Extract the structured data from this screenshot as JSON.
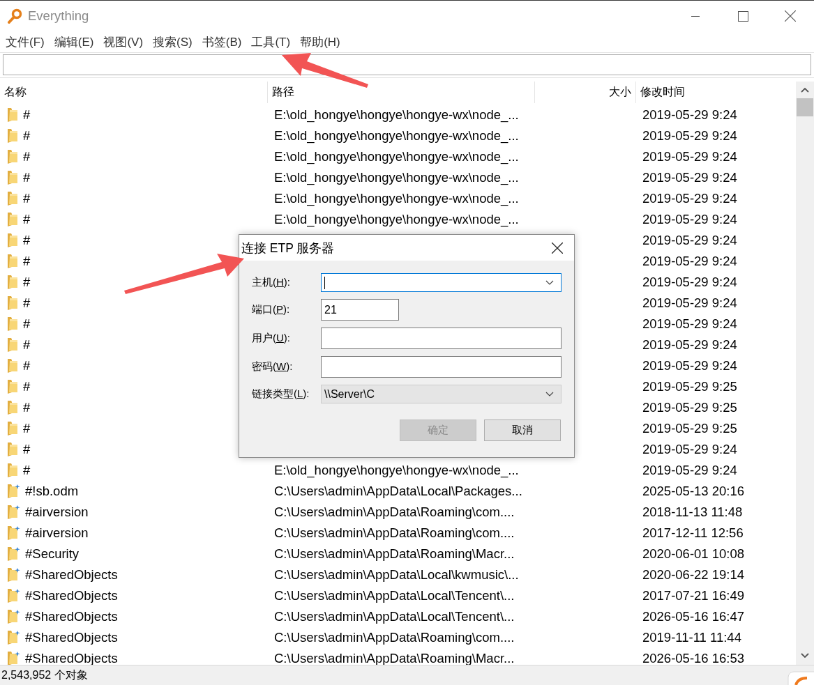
{
  "window": {
    "title": "Everything"
  },
  "menu": [
    "文件(F)",
    "编辑(E)",
    "视图(V)",
    "搜索(S)",
    "书签(B)",
    "工具(T)",
    "帮助(H)"
  ],
  "table": {
    "columns": [
      "名称",
      "路径",
      "大小",
      "修改时间"
    ],
    "rows": [
      {
        "kind": "folder",
        "name": "#",
        "path": "E:\\old_hongye\\hongye\\hongye-wx\\node_...",
        "modified": "2019-05-29 9:24"
      },
      {
        "kind": "folder",
        "name": "#",
        "path": "E:\\old_hongye\\hongye\\hongye-wx\\node_...",
        "modified": "2019-05-29 9:24"
      },
      {
        "kind": "folder",
        "name": "#",
        "path": "E:\\old_hongye\\hongye\\hongye-wx\\node_...",
        "modified": "2019-05-29 9:24"
      },
      {
        "kind": "folder",
        "name": "#",
        "path": "E:\\old_hongye\\hongye\\hongye-wx\\node_...",
        "modified": "2019-05-29 9:24"
      },
      {
        "kind": "folder",
        "name": "#",
        "path": "E:\\old_hongye\\hongye\\hongye-wx\\node_...",
        "modified": "2019-05-29 9:24"
      },
      {
        "kind": "folder",
        "name": "#",
        "path": "E:\\old_hongye\\hongye\\hongye-wx\\node_...",
        "modified": "2019-05-29 9:24"
      },
      {
        "kind": "folder",
        "name": "#",
        "modified": "2019-05-29 9:24"
      },
      {
        "kind": "folder",
        "name": "#",
        "modified": "2019-05-29 9:24"
      },
      {
        "kind": "folder",
        "name": "#",
        "modified": "2019-05-29 9:24"
      },
      {
        "kind": "folder",
        "name": "#",
        "modified": "2019-05-29 9:24"
      },
      {
        "kind": "folder",
        "name": "#",
        "modified": "2019-05-29 9:24"
      },
      {
        "kind": "folder",
        "name": "#",
        "modified": "2019-05-29 9:24"
      },
      {
        "kind": "folder",
        "name": "#",
        "modified": "2019-05-29 9:24"
      },
      {
        "kind": "folder",
        "name": "#",
        "modified": "2019-05-29 9:25"
      },
      {
        "kind": "folder",
        "name": "#",
        "modified": "2019-05-29 9:25"
      },
      {
        "kind": "folder",
        "name": "#",
        "modified": "2019-05-29 9:25"
      },
      {
        "kind": "folder",
        "name": "#",
        "modified": "2019-05-29 9:24"
      },
      {
        "kind": "folder",
        "name": "#",
        "path": "E:\\old_hongye\\hongye\\hongye-wx\\node_...",
        "modified": "2019-05-29 9:24"
      },
      {
        "kind": "marked",
        "name": "#!sb.odm",
        "path": "C:\\Users\\admin\\AppData\\Local\\Packages...",
        "modified": "2025-05-13 20:16"
      },
      {
        "kind": "marked",
        "name": "#airversion",
        "path": "C:\\Users\\admin\\AppData\\Roaming\\com....",
        "modified": "2018-11-13 11:48"
      },
      {
        "kind": "marked",
        "name": "#airversion",
        "path": "C:\\Users\\admin\\AppData\\Roaming\\com....",
        "modified": "2017-12-11 12:56"
      },
      {
        "kind": "marked",
        "name": "#Security",
        "path": "C:\\Users\\admin\\AppData\\Roaming\\Macr...",
        "modified": "2020-06-01 10:08"
      },
      {
        "kind": "marked",
        "name": "#SharedObjects",
        "path": "C:\\Users\\admin\\AppData\\Local\\kwmusic\\...",
        "modified": "2020-06-22 19:14"
      },
      {
        "kind": "marked",
        "name": "#SharedObjects",
        "path": "C:\\Users\\admin\\AppData\\Local\\Tencent\\...",
        "modified": "2017-07-21 16:49"
      },
      {
        "kind": "marked",
        "name": "#SharedObjects",
        "path": "C:\\Users\\admin\\AppData\\Local\\Tencent\\...",
        "modified": "2026-05-16 16:47"
      },
      {
        "kind": "marked",
        "name": "#SharedObjects",
        "path": "C:\\Users\\admin\\AppData\\Roaming\\com....",
        "modified": "2019-11-11 11:44"
      },
      {
        "kind": "marked",
        "name": "#SharedObjects",
        "path": "C:\\Users\\admin\\AppData\\Roaming\\Macr...",
        "modified": "2026-05-16 16:53"
      }
    ]
  },
  "status_bar": {
    "text": "2,543,952 个对象"
  },
  "dialog": {
    "title": "连接 ETP 服务器",
    "fields": [
      {
        "kind": "combo",
        "label": "主机(",
        "key": "H",
        "label_end": "):",
        "focused": true
      },
      {
        "kind": "short",
        "label": "端口(",
        "key": "P",
        "label_end": "):",
        "value": "21",
        "focused": false
      },
      {
        "kind": "text",
        "label": "用户(",
        "key": "U",
        "label_end": "):",
        "focused": false
      },
      {
        "kind": "text",
        "label": "密码(",
        "key": "W",
        "label_end": "):",
        "focused": false
      },
      {
        "kind": "select",
        "label": "链接类型(",
        "key": "L",
        "label_end": "):",
        "value": "\\\\Server\\C",
        "focused": false
      }
    ],
    "buttons": [
      {
        "label": "确定",
        "disabled": true
      },
      {
        "label": "取消",
        "disabled": false
      }
    ]
  }
}
